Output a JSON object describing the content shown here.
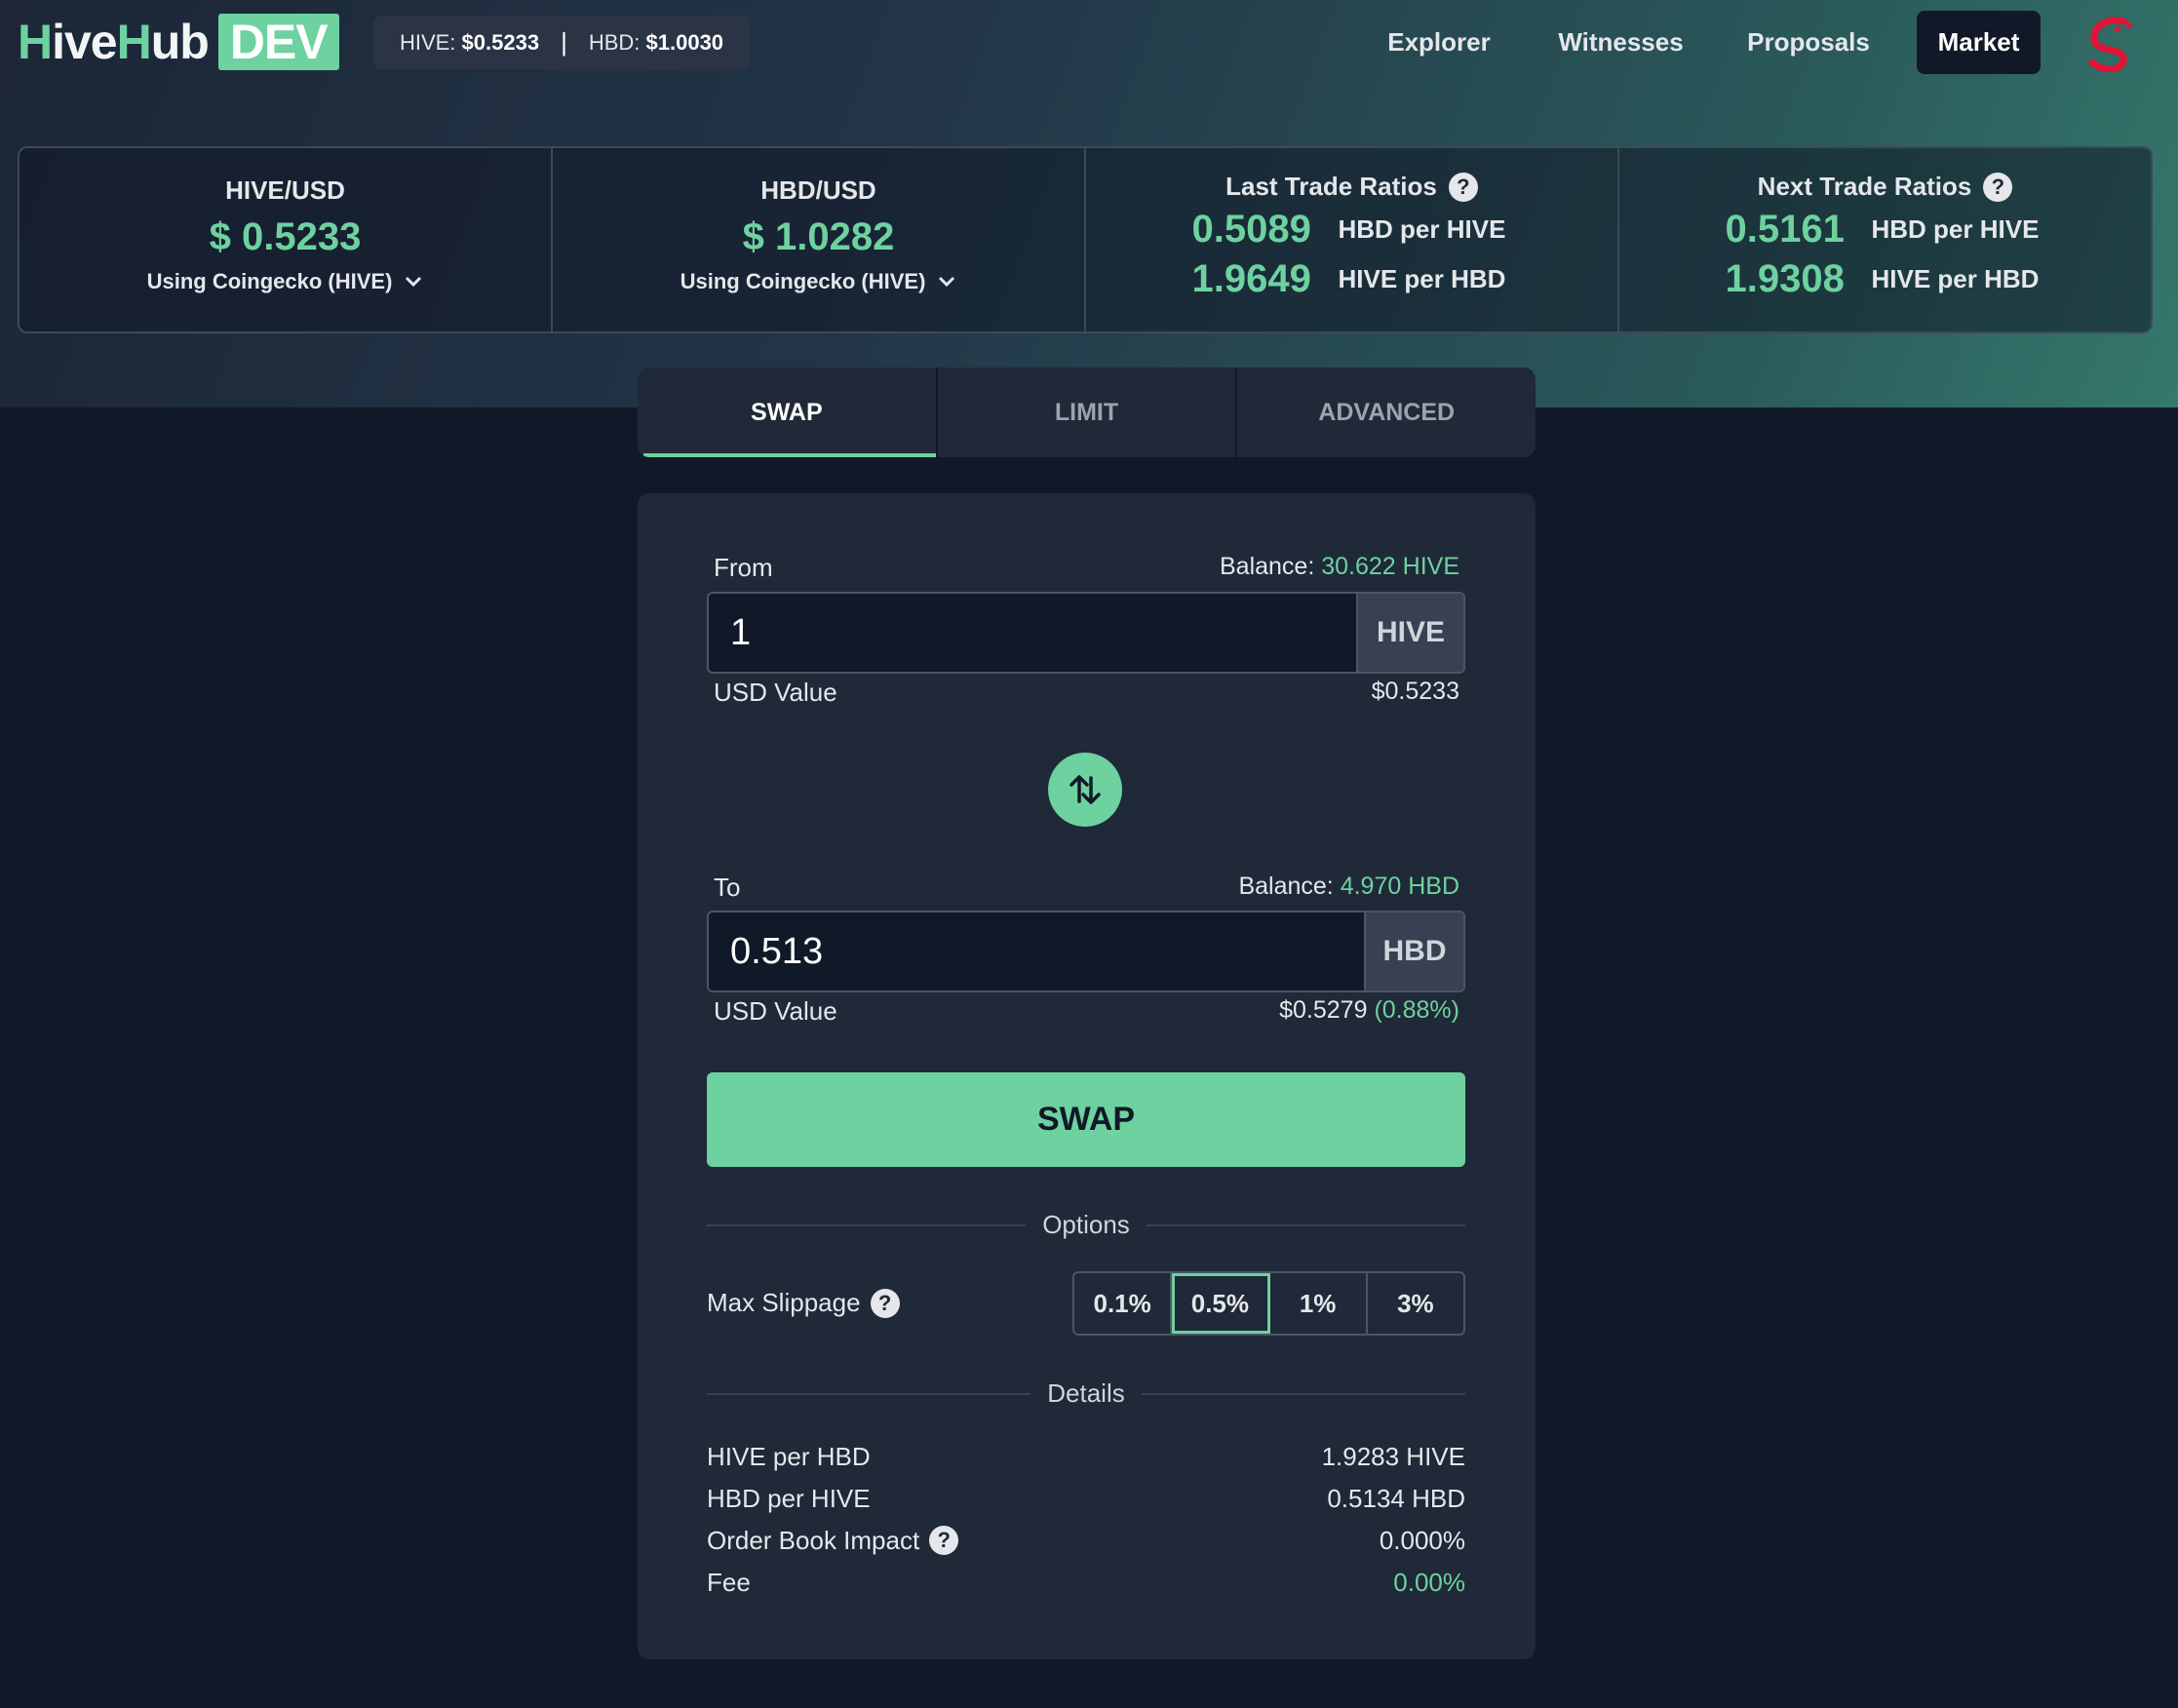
{
  "brand": {
    "part1": "H",
    "part2": "ive",
    "part3": "H",
    "part4": "ub",
    "badge": "DEV"
  },
  "ticker": {
    "hive_label": "HIVE:",
    "hive_value": "$0.5233",
    "separator": "|",
    "hbd_label": "HBD:",
    "hbd_value": "$1.0030"
  },
  "nav": {
    "items": [
      {
        "label": "Explorer",
        "active": false
      },
      {
        "label": "Witnesses",
        "active": false
      },
      {
        "label": "Proposals",
        "active": false
      },
      {
        "label": "Market",
        "active": true
      }
    ],
    "logo_icon": "hive-logo-icon"
  },
  "stats": {
    "hive_usd": {
      "title": "HIVE/USD",
      "price": "$ 0.5233",
      "source": "Using Coingecko (HIVE)"
    },
    "hbd_usd": {
      "title": "HBD/USD",
      "price": "$ 1.0282",
      "source": "Using Coingecko (HIVE)"
    },
    "last_trade": {
      "title": "Last Trade Ratios",
      "rows": [
        {
          "value": "0.5089",
          "label": "HBD per HIVE"
        },
        {
          "value": "1.9649",
          "label": "HIVE per HBD"
        }
      ]
    },
    "next_trade": {
      "title": "Next Trade Ratios",
      "rows": [
        {
          "value": "0.5161",
          "label": "HBD per HIVE"
        },
        {
          "value": "1.9308",
          "label": "HIVE per HBD"
        }
      ]
    }
  },
  "tabs": [
    {
      "label": "SWAP",
      "active": true
    },
    {
      "label": "LIMIT",
      "active": false
    },
    {
      "label": "ADVANCED",
      "active": false
    }
  ],
  "swap": {
    "from": {
      "label": "From",
      "balance_label": "Balance:",
      "balance_value": "30.622 HIVE",
      "amount": "1",
      "unit": "HIVE",
      "usd_label": "USD Value",
      "usd_value": "$0.5233"
    },
    "to": {
      "label": "To",
      "balance_label": "Balance:",
      "balance_value": "4.970 HBD",
      "amount": "0.513",
      "unit": "HBD",
      "usd_label": "USD Value",
      "usd_value": "$0.5279",
      "usd_diff": "(0.88%)"
    },
    "button": "SWAP"
  },
  "options": {
    "heading": "Options",
    "slippage_label": "Max Slippage",
    "slippage_choices": [
      "0.1%",
      "0.5%",
      "1%",
      "3%"
    ],
    "slippage_selected": "0.5%"
  },
  "details": {
    "heading": "Details",
    "rows": [
      {
        "label": "HIVE per HBD",
        "value": "1.9283 HIVE"
      },
      {
        "label": "HBD per HIVE",
        "value": "0.5134 HBD"
      },
      {
        "label": "Order Book Impact",
        "value": "0.000%"
      },
      {
        "label": "Fee",
        "value": "0.00%"
      }
    ]
  },
  "help_glyph": "?",
  "colors": {
    "accent": "#6ed1a0",
    "background": "#111827",
    "panel": "#1f2937",
    "hive_red": "#e31337"
  }
}
